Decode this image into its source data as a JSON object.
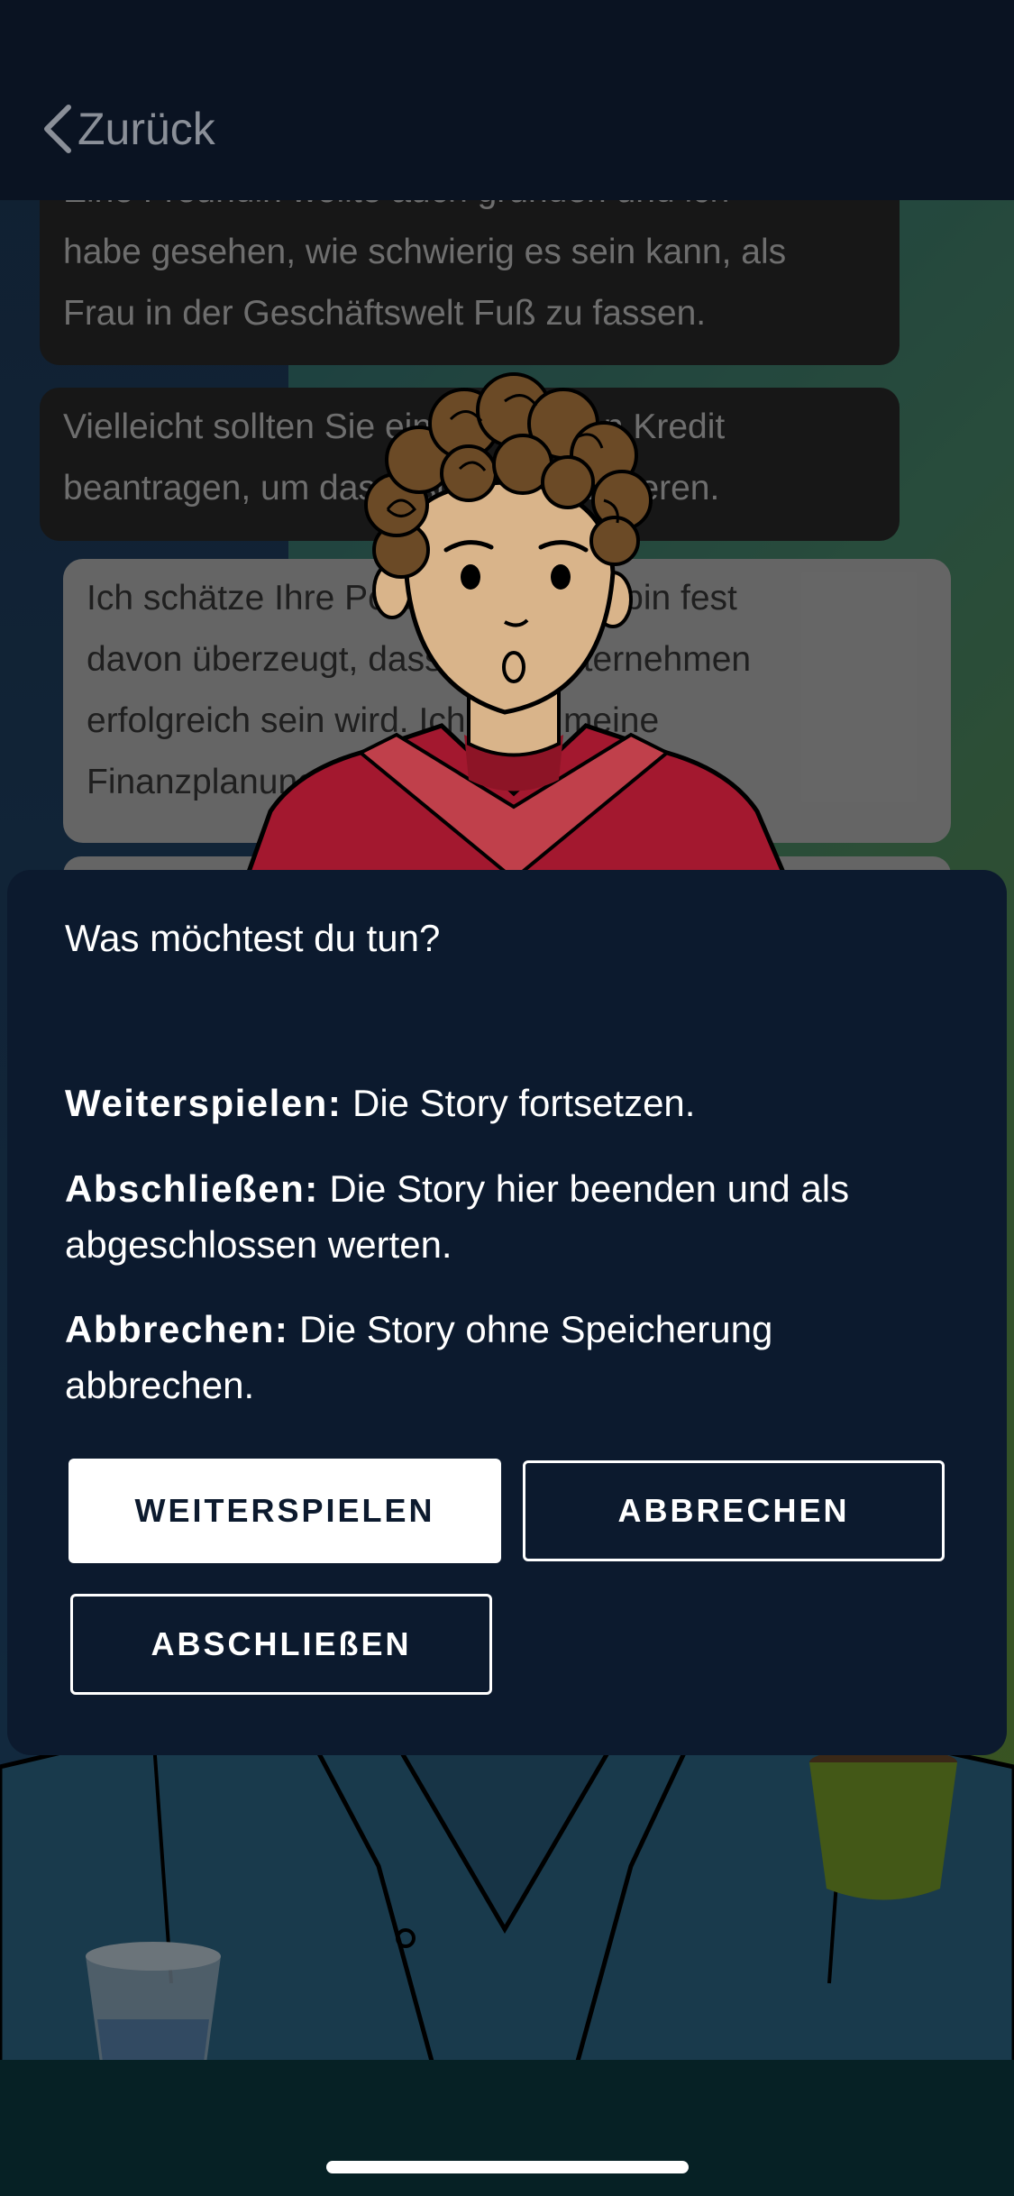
{
  "nav": {
    "back_label": "Zurück"
  },
  "chat": {
    "messages": [
      {
        "role": "npc",
        "lines": [
          "Eine Freundin wollte auch gründen und ich",
          "habe gesehen, wie schwierig es sein kann, als",
          "Frau in der Geschäftswelt Fuß zu fassen."
        ]
      },
      {
        "role": "npc",
        "lines": [
          "Vielleicht sollten Sie einen kleineren Kredit",
          "beantragen, um das Risiko zu minimieren."
        ]
      },
      {
        "role": "player",
        "lines": [
          "Ich schätze Ihre Position, aber ich bin fest",
          "davon überzeugt, dass mein Unternehmen",
          "erfolgreich sein wird. Ich habe meine",
          "Finanzplanung sorgfältig ausgearbeitet."
        ]
      }
    ]
  },
  "dialog": {
    "title": "Was möchtest du tun?",
    "options": [
      {
        "label": "Weiterspielen:",
        "text": " Die Story fortsetzen."
      },
      {
        "label": "Abschließen:",
        "text": " Die Story hier beenden und als abgeschlossen werten."
      },
      {
        "label": "Abbrechen:",
        "text": " Die Story ohne Speicherung abbrechen."
      }
    ],
    "buttons": {
      "continue": "WEITERSPIELEN",
      "cancel": "ABBRECHEN",
      "finish": "ABSCHLIEßEN"
    }
  },
  "icons": {
    "back": "chevron-left-icon"
  },
  "colors": {
    "topbar": "#0a1322",
    "dialog_bg": "#0c1a2e",
    "primary_button_bg": "#ffffff",
    "character_hoodie": "#a3182f"
  }
}
